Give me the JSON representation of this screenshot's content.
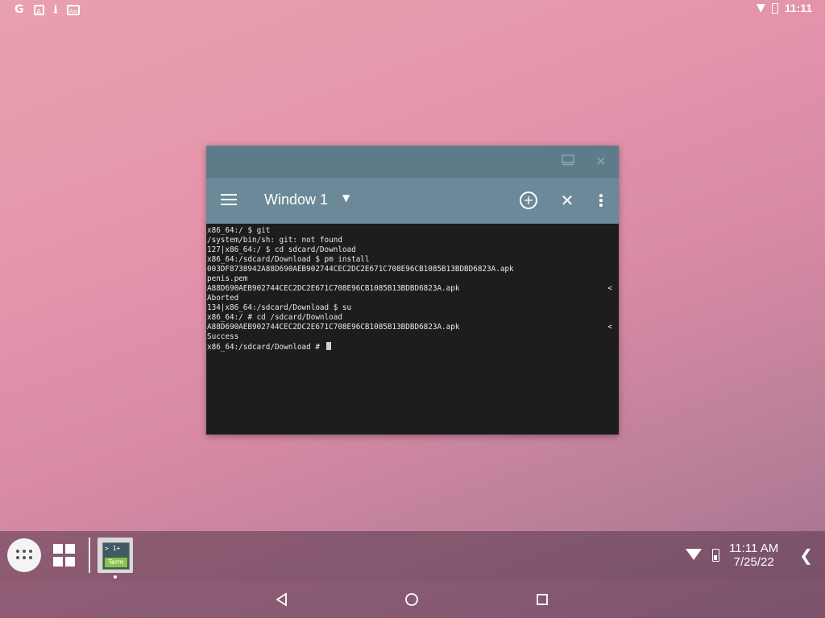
{
  "statusbar": {
    "left_icons": [
      "google-icon",
      "accessibility-icon",
      "download-icon",
      "subtitles-icon"
    ],
    "google_glyph": "G",
    "a11y_glyph": "A",
    "sub_glyph": "A≡",
    "time": "11:11"
  },
  "window": {
    "title": "Window 1",
    "titlebar_buttons": [
      "maximize",
      "close"
    ],
    "terminal_lines": [
      {
        "text": "x86_64:/ $ git",
        "mark": ""
      },
      {
        "text": "/system/bin/sh: git: not found",
        "mark": ""
      },
      {
        "text": "127|x86_64:/ $ cd sdcard/Download",
        "mark": ""
      },
      {
        "text": "x86_64:/sdcard/Download $ pm install",
        "mark": ""
      },
      {
        "text": "003DF8738942A88D690AEB902744CEC2DC2E671C708E96CB1085B13BDBD6823A.apk",
        "mark": ""
      },
      {
        "text": "penis.pem",
        "mark": ""
      },
      {
        "text": "A88D690AEB902744CEC2DC2E671C708E96CB1085B13BDBD6823A.apk",
        "mark": "<"
      },
      {
        "text": "Aborted",
        "mark": ""
      },
      {
        "text": "134|x86_64:/sdcard/Download $ su",
        "mark": ""
      },
      {
        "text": "x86_64:/ # cd /sdcard/Download",
        "mark": ""
      },
      {
        "text": "A88D690AEB902744CEC2DC2E671C708E96CB1085B13BDBD6823A.apk",
        "mark": "<"
      },
      {
        "text": "Success",
        "mark": ""
      },
      {
        "text": "x86_64:/sdcard/Download # ",
        "mark": "",
        "cursor": true
      }
    ]
  },
  "taskbar": {
    "term_app_prompt": "> 1+",
    "term_app_label": "Term",
    "clock_time": "11:11 AM",
    "clock_date": "7/25/22",
    "chevron": "❮"
  },
  "colors": {
    "window_titlebar": "#5e7b8a",
    "window_appbar": "#6b8998",
    "terminal_bg": "#1d1d1d"
  }
}
